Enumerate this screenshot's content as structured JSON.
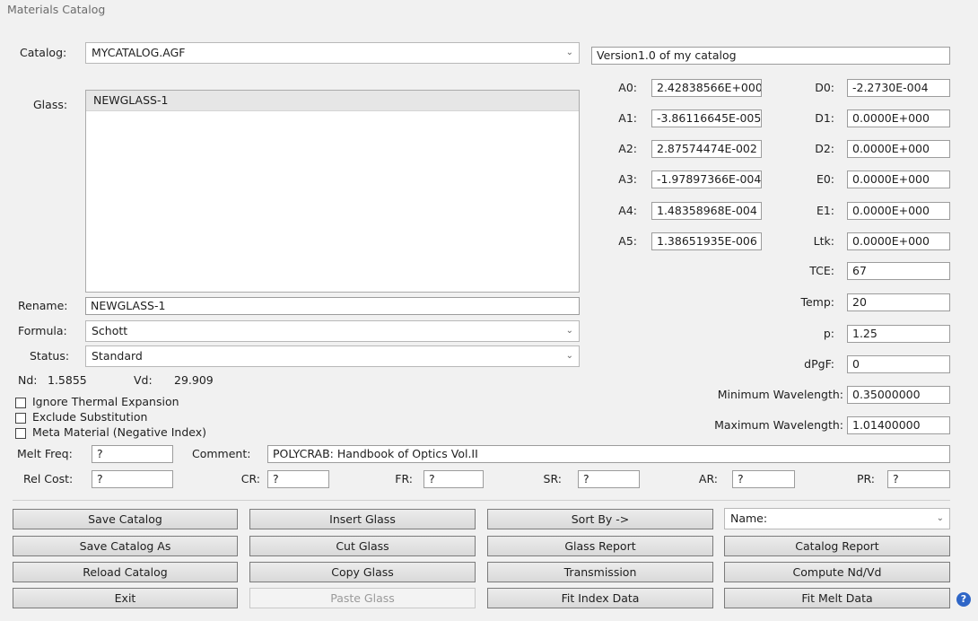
{
  "window": {
    "title": "Materials Catalog"
  },
  "catalog": {
    "label": "Catalog:",
    "value": "MYCATALOG.AGF",
    "description": "Version1.0 of my catalog"
  },
  "glass": {
    "label": "Glass:",
    "items": [
      "NEWGLASS-1"
    ]
  },
  "rename": {
    "label": "Rename:",
    "value": "NEWGLASS-1"
  },
  "formula": {
    "label": "Formula:",
    "value": "Schott"
  },
  "status": {
    "label": "Status:",
    "value": "Standard"
  },
  "nd": {
    "label": "Nd:",
    "value": "1.5855"
  },
  "vd": {
    "label": "Vd:",
    "value": "29.909"
  },
  "checkboxes": {
    "ignore_thermal": "Ignore Thermal Expansion",
    "exclude_sub": "Exclude Substitution",
    "meta_material": "Meta Material (Negative Index)"
  },
  "coeffs": {
    "A0": {
      "label": "A0:",
      "value": "2.42838566E+000"
    },
    "A1": {
      "label": "A1:",
      "value": "-3.86116645E-005"
    },
    "A2": {
      "label": "A2:",
      "value": "2.87574474E-002"
    },
    "A3": {
      "label": "A3:",
      "value": "-1.97897366E-004"
    },
    "A4": {
      "label": "A4:",
      "value": "1.48358968E-004"
    },
    "A5": {
      "label": "A5:",
      "value": "1.38651935E-006"
    },
    "D0": {
      "label": "D0:",
      "value": "-2.2730E-004"
    },
    "D1": {
      "label": "D1:",
      "value": "0.0000E+000"
    },
    "D2": {
      "label": "D2:",
      "value": "0.0000E+000"
    },
    "E0": {
      "label": "E0:",
      "value": "0.0000E+000"
    },
    "E1": {
      "label": "E1:",
      "value": "0.0000E+000"
    },
    "Ltk": {
      "label": "Ltk:",
      "value": "0.0000E+000"
    },
    "TCE": {
      "label": "TCE:",
      "value": "67"
    },
    "Temp": {
      "label": "Temp:",
      "value": "20"
    },
    "p": {
      "label": "p:",
      "value": "1.25"
    },
    "dPgF": {
      "label": "dPgF:",
      "value": "0"
    }
  },
  "wavelength": {
    "min_label": "Minimum Wavelength:",
    "min_value": "0.35000000",
    "max_label": "Maximum Wavelength:",
    "max_value": "1.01400000"
  },
  "melt_freq": {
    "label": "Melt Freq:",
    "value": "?"
  },
  "comment": {
    "label": "Comment:",
    "value": "POLYCRAB: Handbook of Optics Vol.II"
  },
  "costs": {
    "rel_cost": {
      "label": "Rel Cost:",
      "value": "?"
    },
    "cr": {
      "label": "CR:",
      "value": "?"
    },
    "fr": {
      "label": "FR:",
      "value": "?"
    },
    "sr": {
      "label": "SR:",
      "value": "?"
    },
    "ar": {
      "label": "AR:",
      "value": "?"
    },
    "pr": {
      "label": "PR:",
      "value": "?"
    }
  },
  "buttons": {
    "save_catalog": "Save Catalog",
    "save_catalog_as": "Save Catalog As",
    "reload_catalog": "Reload Catalog",
    "exit": "Exit",
    "insert_glass": "Insert Glass",
    "cut_glass": "Cut Glass",
    "copy_glass": "Copy Glass",
    "paste_glass": "Paste Glass",
    "sort_by": "Sort By ->",
    "glass_report": "Glass Report",
    "transmission": "Transmission",
    "fit_index_data": "Fit Index Data",
    "catalog_report": "Catalog Report",
    "compute_nd_vd": "Compute Nd/Vd",
    "fit_melt_data": "Fit Melt Data"
  },
  "sort": {
    "value": "Name:"
  },
  "help": {
    "glyph": "?"
  },
  "icons": {
    "chevron": "chevron-down-icon",
    "help": "help-icon"
  },
  "colors": {
    "background": "#f1f1f1",
    "help_blue": "#2f66c7",
    "disabled_text": "#9a9a9a"
  }
}
